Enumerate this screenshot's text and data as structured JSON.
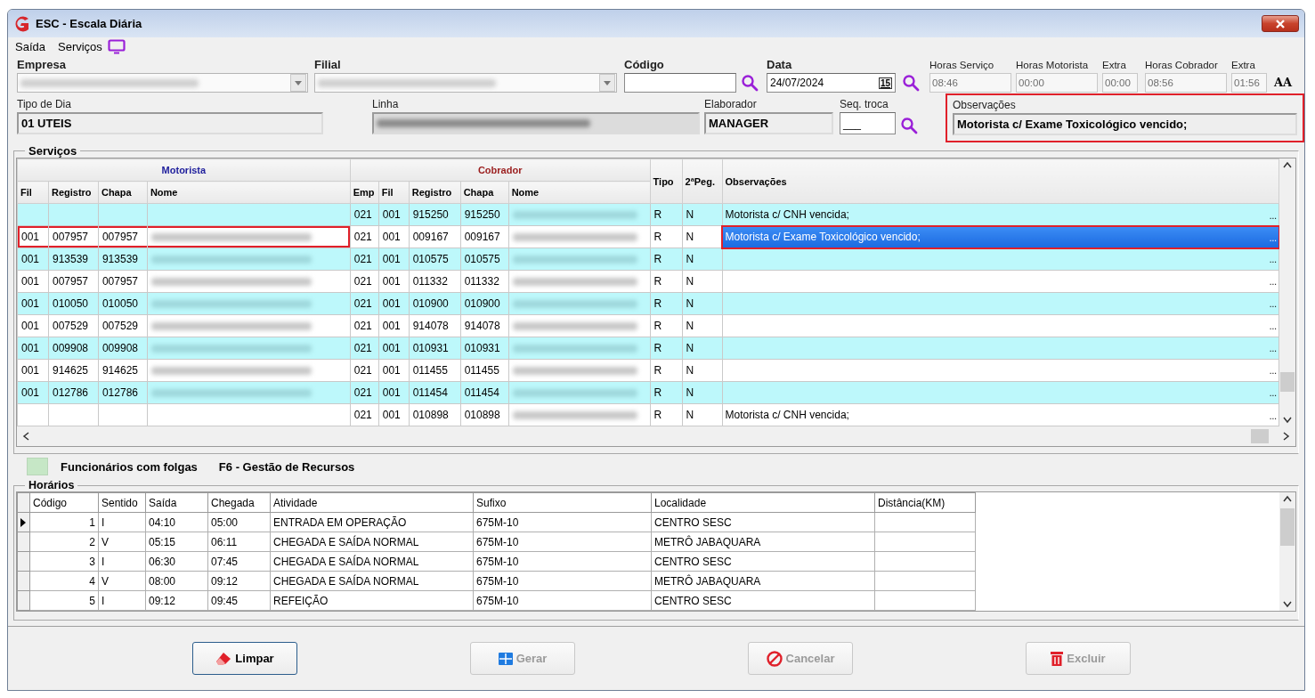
{
  "window": {
    "title": "ESC - Escala Diária"
  },
  "menu": [
    {
      "label": "Saída"
    },
    {
      "label": "Serviços"
    }
  ],
  "header": {
    "empresa": {
      "label": "Empresa"
    },
    "filial": {
      "label": "Filial"
    },
    "codigo": {
      "label": "Código"
    },
    "data": {
      "label": "Data",
      "value": "24/07/2024",
      "calendar_day": "15"
    },
    "horas": [
      {
        "label": "Horas Serviço",
        "value": "08:46",
        "kind": "main"
      },
      {
        "label": "Horas Motorista",
        "value": "00:00",
        "kind": "main"
      },
      {
        "label": "Extra",
        "value": "00:00",
        "kind": "extra"
      },
      {
        "label": "Horas Cobrador",
        "value": "08:56",
        "kind": "main"
      },
      {
        "label": "Extra",
        "value": "01:56",
        "kind": "extra"
      }
    ],
    "font_button": "AA",
    "tipo_dia": {
      "label": "Tipo de Dia",
      "value": "01 UTEIS"
    },
    "linha": {
      "label": "Linha"
    },
    "elaborador": {
      "label": "Elaborador",
      "value": "MANAGER"
    },
    "seq_troca": {
      "label": "Seq. troca",
      "value": "___"
    },
    "observacoes": {
      "label": "Observações",
      "value": "Motorista c/ Exame Toxicológico vencido;",
      "highlighted": true
    }
  },
  "servicos": {
    "title": "Serviços",
    "motorista_label": "Motorista",
    "cobrador_label": "Cobrador",
    "motorista_columns": [
      "Fil",
      "Registro",
      "Chapa",
      "Nome"
    ],
    "cobrador_columns": [
      "Emp",
      "Fil",
      "Registro",
      "Chapa",
      "Nome"
    ],
    "other_columns": [
      "Tipo",
      "2ªPeg.",
      "Observações"
    ],
    "rows": [
      {
        "cobrador": {
          "emp": "021",
          "fil": "001",
          "registro": "915250",
          "chapa": "915250"
        },
        "tipo": "R",
        "peg2": "N",
        "obs": "Motorista c/ CNH vencida;",
        "ellipsis": "...",
        "selected": false,
        "highlighted": false
      },
      {
        "motorista": {
          "fil": "001",
          "registro": "007957",
          "chapa": "007957"
        },
        "cobrador": {
          "emp": "021",
          "fil": "001",
          "registro": "009167",
          "chapa": "009167"
        },
        "tipo": "R",
        "peg2": "N",
        "obs": "Motorista c/ Exame Toxicológico vencido;",
        "ellipsis": "...",
        "selected": true,
        "highlighted": true
      },
      {
        "motorista": {
          "fil": "001",
          "registro": "913539",
          "chapa": "913539"
        },
        "cobrador": {
          "emp": "021",
          "fil": "001",
          "registro": "010575",
          "chapa": "010575"
        },
        "tipo": "R",
        "peg2": "N",
        "ellipsis": "...",
        "selected": false,
        "highlighted": false
      },
      {
        "motorista": {
          "fil": "001",
          "registro": "007957",
          "chapa": "007957"
        },
        "cobrador": {
          "emp": "021",
          "fil": "001",
          "registro": "011332",
          "chapa": "011332"
        },
        "tipo": "R",
        "peg2": "N",
        "ellipsis": "...",
        "selected": false,
        "highlighted": false
      },
      {
        "motorista": {
          "fil": "001",
          "registro": "010050",
          "chapa": "010050"
        },
        "cobrador": {
          "emp": "021",
          "fil": "001",
          "registro": "010900",
          "chapa": "010900"
        },
        "tipo": "R",
        "peg2": "N",
        "ellipsis": "...",
        "selected": false,
        "highlighted": false
      },
      {
        "motorista": {
          "fil": "001",
          "registro": "007529",
          "chapa": "007529"
        },
        "cobrador": {
          "emp": "021",
          "fil": "001",
          "registro": "914078",
          "chapa": "914078"
        },
        "tipo": "R",
        "peg2": "N",
        "ellipsis": "...",
        "selected": false,
        "highlighted": false
      },
      {
        "motorista": {
          "fil": "001",
          "registro": "009908",
          "chapa": "009908"
        },
        "cobrador": {
          "emp": "021",
          "fil": "001",
          "registro": "010931",
          "chapa": "010931"
        },
        "tipo": "R",
        "peg2": "N",
        "ellipsis": "...",
        "selected": false,
        "highlighted": false
      },
      {
        "motorista": {
          "fil": "001",
          "registro": "914625",
          "chapa": "914625"
        },
        "cobrador": {
          "emp": "021",
          "fil": "001",
          "registro": "011455",
          "chapa": "011455"
        },
        "tipo": "R",
        "peg2": "N",
        "ellipsis": "...",
        "selected": false,
        "highlighted": false
      },
      {
        "motorista": {
          "fil": "001",
          "registro": "012786",
          "chapa": "012786"
        },
        "cobrador": {
          "emp": "021",
          "fil": "001",
          "registro": "011454",
          "chapa": "011454"
        },
        "tipo": "R",
        "peg2": "N",
        "ellipsis": "...",
        "selected": false,
        "highlighted": false
      },
      {
        "cobrador": {
          "emp": "021",
          "fil": "001",
          "registro": "010898",
          "chapa": "010898"
        },
        "tipo": "R",
        "peg2": "N",
        "obs": "Motorista c/ CNH vencida;",
        "ellipsis": "...",
        "selected": false,
        "highlighted": false
      }
    ]
  },
  "legend": {
    "label": "Funcionários com folgas",
    "shortcut": "F6 - Gestão de Recursos"
  },
  "horarios": {
    "title": "Horários",
    "columns": [
      "Código",
      "Sentido",
      "Saída",
      "Chegada",
      "Atividade",
      "Sufixo",
      "Localidade",
      "Distância(KM)"
    ],
    "rows": [
      {
        "codigo": "1",
        "sentido": "I",
        "saida": "04:10",
        "chegada": "05:00",
        "atividade": "ENTRADA EM OPERAÇÃO",
        "sufixo": "675M-10",
        "localidade": "CENTRO SESC",
        "selected": true
      },
      {
        "codigo": "2",
        "sentido": "V",
        "saida": "05:15",
        "chegada": "06:11",
        "atividade": "CHEGADA E SAÍDA NORMAL",
        "sufixo": "675M-10",
        "localidade": "METRÔ JABAQUARA",
        "selected": false
      },
      {
        "codigo": "3",
        "sentido": "I",
        "saida": "06:30",
        "chegada": "07:45",
        "atividade": "CHEGADA E SAÍDA NORMAL",
        "sufixo": "675M-10",
        "localidade": "CENTRO SESC",
        "selected": false
      },
      {
        "codigo": "4",
        "sentido": "V",
        "saida": "08:00",
        "chegada": "09:12",
        "atividade": "CHEGADA E SAÍDA NORMAL",
        "sufixo": "675M-10",
        "localidade": "METRÔ JABAQUARA",
        "selected": false
      },
      {
        "codigo": "5",
        "sentido": "I",
        "saida": "09:12",
        "chegada": "09:45",
        "atividade": "REFEIÇÃO",
        "sufixo": "675M-10",
        "localidade": "CENTRO SESC",
        "selected": false
      }
    ]
  },
  "buttons": [
    {
      "label": "Limpar",
      "kind": "limpar",
      "disabled": false
    },
    {
      "label": "Gerar",
      "kind": "gerar",
      "disabled": true
    },
    {
      "label": "Cancelar",
      "kind": "cancelar",
      "disabled": true
    },
    {
      "label": "Excluir",
      "kind": "excluir",
      "disabled": true
    }
  ]
}
